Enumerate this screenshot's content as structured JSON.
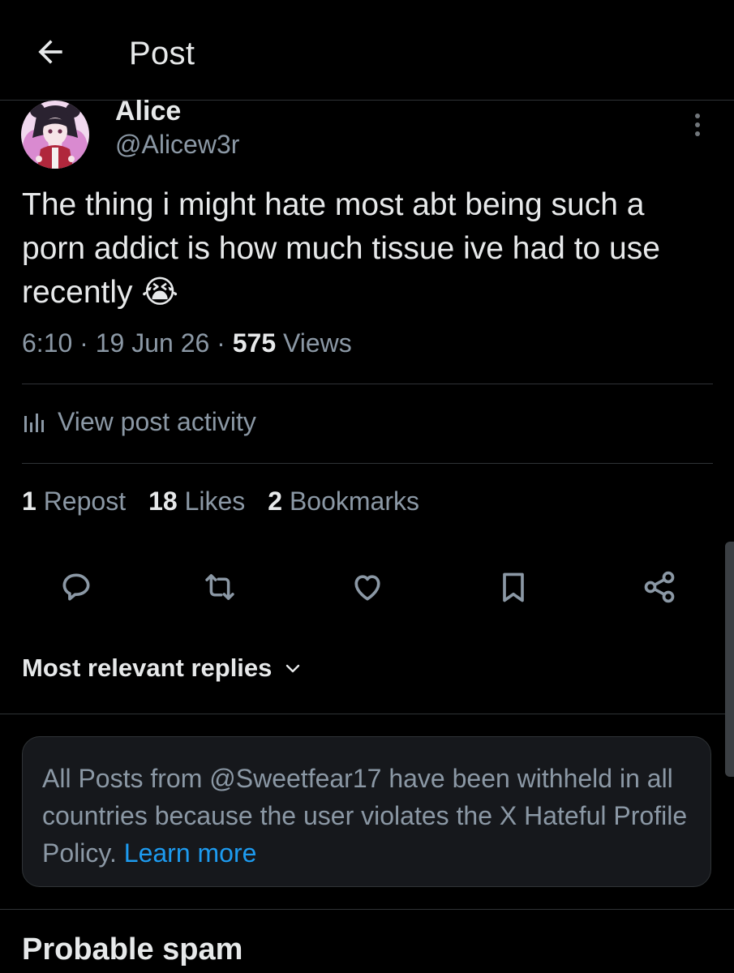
{
  "header": {
    "back_icon": "arrow-left-icon",
    "title": "Post"
  },
  "post": {
    "author": {
      "name": "Alice",
      "handle": "@Alicew3r",
      "avatar_icon": "profile-avatar"
    },
    "more_icon": "more-vertical-icon",
    "text": "The thing i might hate most abt being such a porn addict is how much tissue ive had to use recently",
    "emoji": "😭",
    "time": "6:10",
    "date": "19 Jun 26",
    "separator": "·",
    "views_count": "575",
    "views_label": "Views"
  },
  "activity": {
    "icon": "analytics-bars-icon",
    "label": "View post activity"
  },
  "stats": {
    "reposts_count": "1",
    "reposts_label": "Repost",
    "likes_count": "18",
    "likes_label": "Likes",
    "bookmarks_count": "2",
    "bookmarks_label": "Bookmarks"
  },
  "actions": {
    "reply_icon": "reply-icon",
    "repost_icon": "repost-icon",
    "like_icon": "heart-icon",
    "bookmark_icon": "bookmark-icon",
    "share_icon": "share-icon"
  },
  "replies": {
    "sort_label": "Most relevant replies",
    "sort_icon": "chevron-down-icon"
  },
  "notice": {
    "text": "All Posts from @Sweetfear17 have been withheld in all countries because the user violates the X Hateful Profile Policy.",
    "link": "Learn more"
  },
  "section": {
    "title": "Probable spam"
  },
  "colors": {
    "background": "#000000",
    "text_primary": "#e7e9ea",
    "text_secondary": "#8b98a5",
    "link": "#1d9bf0",
    "divider": "#2f3336",
    "notice_bg": "#16181c"
  }
}
